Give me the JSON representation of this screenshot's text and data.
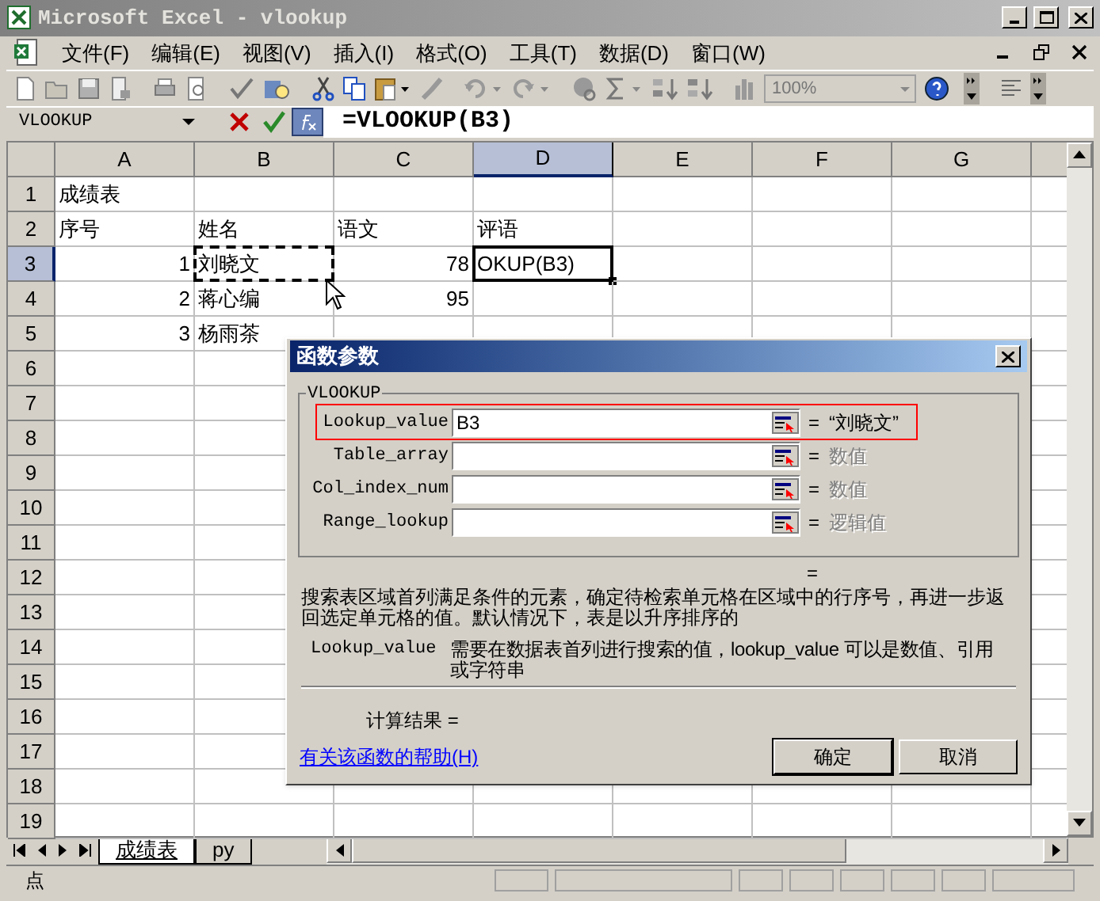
{
  "window": {
    "title": "Microsoft Excel - vlookup"
  },
  "menu": [
    "文件(F)",
    "编辑(E)",
    "视图(V)",
    "插入(I)",
    "格式(O)",
    "工具(T)",
    "数据(D)",
    "窗口(W)"
  ],
  "toolbar": {
    "zoom": "100%"
  },
  "formula_bar": {
    "name_box": "VLOOKUP",
    "formula": "=VLOOKUP(B3)"
  },
  "columns": [
    {
      "label": "A",
      "selected": false
    },
    {
      "label": "B",
      "selected": false
    },
    {
      "label": "C",
      "selected": false
    },
    {
      "label": "D",
      "selected": true
    },
    {
      "label": "E",
      "selected": false
    },
    {
      "label": "F",
      "selected": false
    },
    {
      "label": "G",
      "selected": false
    }
  ],
  "rows": [
    {
      "number": "1",
      "selected": false,
      "cells": {
        "A": {
          "text": "成绩表",
          "kind": "text"
        }
      }
    },
    {
      "number": "2",
      "selected": false,
      "cells": {
        "A": {
          "text": "序号",
          "kind": "text"
        },
        "B": {
          "text": "姓名",
          "kind": "text"
        },
        "C": {
          "text": "语文",
          "kind": "text"
        },
        "D": {
          "text": "评语",
          "kind": "text"
        }
      }
    },
    {
      "number": "3",
      "selected": true,
      "cells": {
        "A": {
          "text": "1",
          "kind": "number"
        },
        "B": {
          "text": "刘晓文",
          "kind": "text",
          "marquee": true
        },
        "C": {
          "text": "78",
          "kind": "number"
        },
        "D": {
          "text": "OKUP(B3)",
          "kind": "text",
          "active": true
        }
      }
    },
    {
      "number": "4",
      "selected": false,
      "cells": {
        "A": {
          "text": "2",
          "kind": "number"
        },
        "B": {
          "text": "蒋心编",
          "kind": "text"
        },
        "C": {
          "text": "95",
          "kind": "number"
        }
      }
    },
    {
      "number": "5",
      "selected": false,
      "cells": {
        "A": {
          "text": "3",
          "kind": "number"
        },
        "B": {
          "text": "杨雨茶",
          "kind": "text"
        }
      }
    },
    {
      "number": "6",
      "selected": false
    },
    {
      "number": "7",
      "selected": false
    },
    {
      "number": "8",
      "selected": false
    },
    {
      "number": "9",
      "selected": false
    },
    {
      "number": "10",
      "selected": false
    },
    {
      "number": "11",
      "selected": false
    },
    {
      "number": "12",
      "selected": false
    },
    {
      "number": "13",
      "selected": false
    },
    {
      "number": "14",
      "selected": false
    },
    {
      "number": "15",
      "selected": false
    },
    {
      "number": "16",
      "selected": false
    },
    {
      "number": "17",
      "selected": false
    },
    {
      "number": "18",
      "selected": false
    },
    {
      "number": "19",
      "selected": false
    }
  ],
  "dialog": {
    "title": "函数参数",
    "group": "VLOOKUP",
    "arguments": [
      {
        "label": "Lookup_value",
        "value": "B3",
        "equals": "=",
        "result": "“刘晓文”",
        "dimmed": false,
        "highlighted": true
      },
      {
        "label": "Table_array",
        "equals": "=",
        "result": "数值",
        "dimmed": true,
        "highlighted": false
      },
      {
        "label": "Col_index_num",
        "equals": "=",
        "result": "数值",
        "dimmed": true,
        "highlighted": false
      },
      {
        "label": "Range_lookup",
        "equals": "=",
        "result": "逻辑值",
        "dimmed": true,
        "highlighted": false
      }
    ],
    "formula_result": "=",
    "description": "搜索表区域首列满足条件的元素，确定待检索单元格在区域中的行序号，再进一步返回选定单元格的值。默认情况下，表是以升序排序的",
    "argument_name": "Lookup_value",
    "argument_help": "需要在数据表首列进行搜索的值，lookup_value 可以是数值、引用或字符串",
    "result_label": "计算结果 =",
    "help_link": "有关该函数的帮助(H)",
    "buttons": [
      "确定",
      "取消"
    ]
  },
  "sheet_tabs": [
    {
      "label": "成绩表",
      "selected": true
    },
    {
      "label": "py",
      "selected": false
    }
  ],
  "status_bar": {
    "mode": "点"
  }
}
